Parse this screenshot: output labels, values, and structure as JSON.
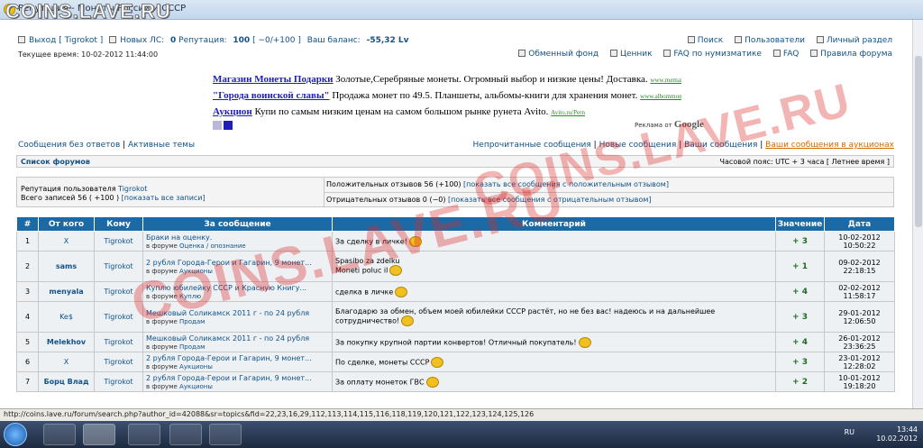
{
  "window": {
    "title": "Репутация - Монеты России и СССР",
    "watermark_top": "COINS.LAVE.RU"
  },
  "header": {
    "logout": "Выход [ Tigrokot ]",
    "new_pm_label": "Новых ЛС:",
    "new_pm_count": "0",
    "reputation_label": "Репутация:",
    "reputation_value": "100",
    "reputation_links": "[ −0/+100 ]",
    "balance_label": "Ваш баланс:",
    "balance_value": "-55,32 Lv",
    "time": "Текущее время: 10-02-2012 11:44:00",
    "right_row1": [
      "Поиск",
      "Пользователи",
      "Личный раздел"
    ],
    "right_row2": [
      "Обменный фонд",
      "Ценник",
      "FAQ по нумизматике",
      "FAQ",
      "Правила форума"
    ]
  },
  "ads": [
    {
      "title": "Магазин Монеты Подарки",
      "text": " Золотые,Серебряные монеты. Огромный выбор и низкие цены! Доставка.",
      "url": "www.memai.n"
    },
    {
      "title": "\"Города воинской славы\"",
      "text": " Продажа монет по 49.5. Планшеты, альбомы-книги для хранения монет.",
      "url": "www.albommonet.r"
    },
    {
      "title": "Аукцион",
      "text": " Купи по самым низким ценам на самом большом рынке рунета Avito.",
      "url": "Avito.ru/Pern"
    }
  ],
  "ads_by": "Реклама от",
  "ads_google": "Google",
  "links_left": [
    "Сообщения без ответов",
    "Активные темы"
  ],
  "links_right": [
    "Непрочитанные сообщения",
    "Новые сообщения",
    "Ваши сообщения"
  ],
  "links_right_highlight": "Ваши сообщения в аукционах",
  "forum_list": "Список форумов",
  "timezone": "Часовой пояс: UTC + 3 часа [ Летнее время ]",
  "reputation_box": {
    "user_label": "Репутация пользователя",
    "user": "Tigrokot",
    "total": "Всего записей 56 ( +100 )",
    "show_all": "[показать все записи]",
    "positive": "Положительных отзывов 56 (+100)",
    "positive_link": "[показать все сообщения с положительным отзывом]",
    "negative": "Отрицательных отзывов 0 (−0)",
    "negative_link": "[показать все сообщения с отрицательным отзывом]"
  },
  "table": {
    "headers": [
      "#",
      "От кого",
      "Кому",
      "За сообщение",
      "Комментарий",
      "Значение",
      "Дата"
    ],
    "rows": [
      {
        "n": "1",
        "from": "X",
        "bold": false,
        "to": "Tigrokot",
        "title": "Браки на оценку.",
        "forum": "Оценка / опознание",
        "comment": "За сделку в личке!",
        "value": "+ 3",
        "date": "10-02-2012",
        "time": "10:50:22"
      },
      {
        "n": "2",
        "from": "sams",
        "bold": true,
        "to": "Tigrokot",
        "title": "2 рубля Города-Герои и Гагарин, 9 монет...",
        "forum": "Аукционы",
        "comment": "Spasibo za zdelku\nMoneti poluc il",
        "value": "+ 1",
        "date": "09-02-2012",
        "time": "22:18:15"
      },
      {
        "n": "3",
        "from": "menyala",
        "bold": true,
        "to": "Tigrokot",
        "title": "Куплю юбилейку СССР и Красную Книгу...",
        "forum": "Куплю",
        "comment": "сделка в личке",
        "value": "+ 4",
        "date": "02-02-2012",
        "time": "11:58:17"
      },
      {
        "n": "4",
        "from": "Ke$",
        "bold": false,
        "to": "Tigrokot",
        "title": "Мешковый Соликамск 2011 г - по 24 рубля",
        "forum": "Продам",
        "comment": "Благодарю за обмен, объем моей юбилейки СССР растёт, но не без вас! надеюсь и на дальнейшее сотрудничество!",
        "value": "+ 3",
        "date": "29-01-2012",
        "time": "12:06:50"
      },
      {
        "n": "5",
        "from": "Melekhov",
        "bold": true,
        "to": "Tigrokot",
        "title": "Мешковый Соликамск 2011 г - по 24 рубля",
        "forum": "Продам",
        "comment": "За покупку крупной партии конвертов! Отличный покупатель!",
        "value": "+ 4",
        "date": "26-01-2012",
        "time": "23:36:25"
      },
      {
        "n": "6",
        "from": "X",
        "bold": false,
        "to": "Tigrokot",
        "title": "2 рубля Города-Герои и Гагарин, 9 монет...",
        "forum": "Аукционы",
        "comment": "По сделке, монеты СССР",
        "value": "+ 3",
        "date": "23-01-2012",
        "time": "12:28:02"
      },
      {
        "n": "7",
        "from": "Борц Влад",
        "bold": true,
        "to": "Tigrokot",
        "title": "2 рубля Города-Герои и Гагарин, 9 монет...",
        "forum": "Аукционы",
        "comment": "За оплату монеток ГВС",
        "value": "+ 2",
        "date": "10-01-2012",
        "time": "19:18:20"
      }
    ],
    "in_forum": "в форуме"
  },
  "status_url": "http://coins.lave.ru/forum/search.php?author_id=42088&sr=topics&fid=22,23,16,29,112,113,114,115,116,118,119,120,121,122,123,124,125,126",
  "watermark_big": "COINS.LAVE.RU",
  "tray": {
    "lang": "RU",
    "time": "13:44",
    "date": "10.02.2012"
  }
}
